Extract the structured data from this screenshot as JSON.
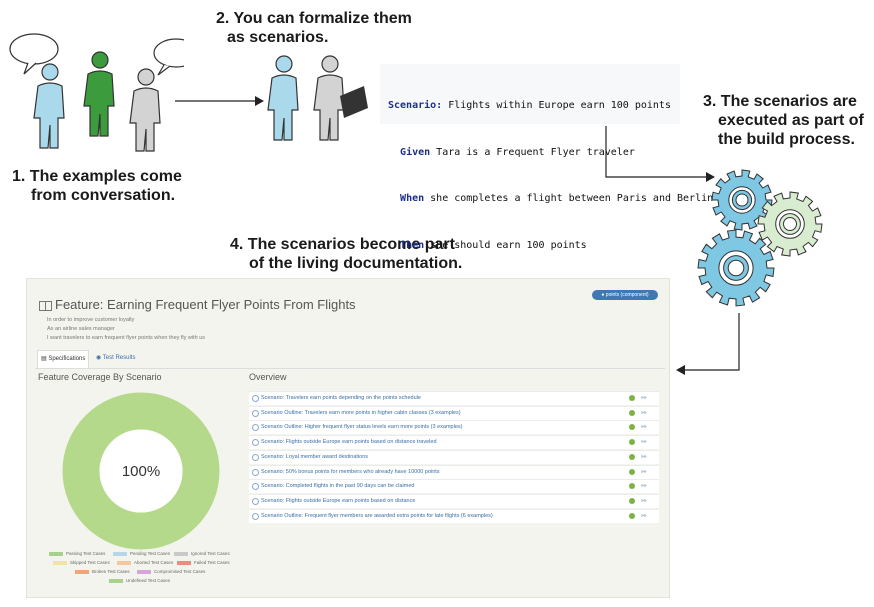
{
  "steps": {
    "step1": [
      "1. The examples come",
      "from conversation."
    ],
    "step2": [
      "2. You can formalize them",
      "as scenarios."
    ],
    "step3": [
      "3. The scenarios are",
      "executed as part of",
      "the build process."
    ],
    "step4": [
      "4. The scenarios become part",
      "of the living documentation."
    ]
  },
  "gherkin": {
    "scenario_kw": "Scenario:",
    "scenario_text": " Flights within Europe earn 100 points",
    "given_kw": "Given",
    "given_text": " Tara is a Frequent Flyer traveler",
    "when_kw": "When",
    "when_text": " she completes a flight between Paris and Berlin",
    "then_kw": "Then",
    "then_text": " she should earn 100 points"
  },
  "doc": {
    "title": "Feature: Earning Frequent Flyer Points From Flights",
    "tag": "points (component)",
    "description": [
      "In order to improve customer loyalty",
      "As an airline sales manager",
      "I want travelers to earn frequent flyer points when they fly with us"
    ],
    "tabs": [
      "Specifications",
      "Test Results"
    ],
    "coverage_title": "Feature Coverage By Scenario",
    "coverage_percent": 100,
    "coverage_label": "100%",
    "overview_title": "Overview",
    "overview_items": [
      "Scenario: Travelers earn points depending on the points schedule",
      "Scenario Outline: Travelers earn more points in higher cabin classes (3 examples)",
      "Scenario Outline: Higher frequent flyer status levels earn more points (3 examples)",
      "Scenario: Flights outside Europe earn points based on distance traveled",
      "Scenario: Loyal member award destinations",
      "Scenario: 50% bonus points for members who already have 10000 points",
      "Scenario: Completed flights in the past 90 days can be claimed",
      "Scenario: Flights outside Europe earn points based on distance",
      "Scenario Outline: Frequent flyer members are awarded extra points for late flights (6 examples)"
    ],
    "overview_link": "»»",
    "legend": [
      {
        "label": "Passing Test Cases",
        "color": "#a9d18e"
      },
      {
        "label": "Pending Test Cases",
        "color": "#b6d7e8"
      },
      {
        "label": "Ignored Test Cases",
        "color": "#c9c9c9"
      },
      {
        "label": "Skipped Test Cases",
        "color": "#f3e3a1"
      },
      {
        "label": "Aborted Test Cases",
        "color": "#f4c7a1"
      },
      {
        "label": "Failed Test Cases",
        "color": "#f08a7e"
      },
      {
        "label": "Broken Test Cases",
        "color": "#f2a478"
      },
      {
        "label": "Compromised Test Cases",
        "color": "#d7a6d9"
      },
      {
        "label": "Undefined Test Cases",
        "color": "#a9d18e"
      }
    ]
  },
  "colors": {
    "person_blue": "#a9d9ea",
    "person_green": "#3c9b3c",
    "person_gray": "#d3d3d3",
    "gear_blue": "#7ec8e3",
    "gear_green": "#d8ecd0",
    "donut": "#b5d98a"
  }
}
